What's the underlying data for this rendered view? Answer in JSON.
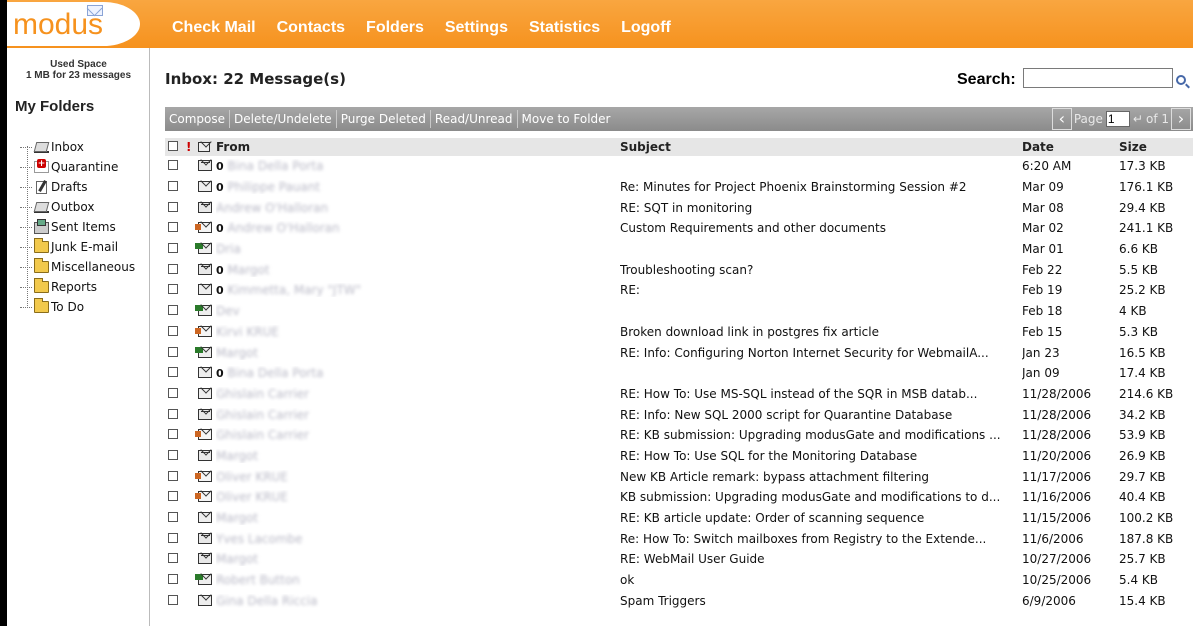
{
  "app": {
    "logo": "modus"
  },
  "nav": [
    "Check Mail",
    "Contacts",
    "Folders",
    "Settings",
    "Statistics",
    "Logoff"
  ],
  "sidebar": {
    "used_space_title": "Used Space",
    "used_space_value": "1 MB for 23 messages",
    "heading": "My Folders",
    "folders": [
      {
        "label": "Inbox",
        "icon": "inbox-icon"
      },
      {
        "label": "Quarantine",
        "icon": "quarantine-icon"
      },
      {
        "label": "Drafts",
        "icon": "drafts-icon"
      },
      {
        "label": "Outbox",
        "icon": "outbox-icon"
      },
      {
        "label": "Sent Items",
        "icon": "sent-items-icon"
      },
      {
        "label": "Junk E-mail",
        "icon": "folder-icon"
      },
      {
        "label": "Miscellaneous",
        "icon": "folder-icon"
      },
      {
        "label": "Reports",
        "icon": "folder-icon"
      },
      {
        "label": "To Do",
        "icon": "folder-icon"
      }
    ]
  },
  "main": {
    "title": "Inbox: 22 Message(s)",
    "search_label": "Search:",
    "search_value": "",
    "toolbar": [
      "Compose",
      "Delete/Undelete",
      "Purge Deleted",
      "Read/Unread",
      "Move to Folder"
    ],
    "pager": {
      "page_label": "Page",
      "page": "1",
      "of_label": "of 1"
    },
    "columns": {
      "flag": "!",
      "from": "From",
      "subject": "Subject",
      "date": "Date",
      "size": "Size"
    },
    "messages": [
      {
        "icon": "reply",
        "att": "0",
        "from": "Bina Della Porta",
        "subject": "",
        "date": "6:20 AM",
        "size": "17.3 KB"
      },
      {
        "icon": "read",
        "att": "0",
        "from": "Philippe Pauant",
        "subject": "Re: Minutes for Project Phoenix Brainstorming Session #2",
        "date": "Mar 09",
        "size": "176.1 KB"
      },
      {
        "icon": "reply",
        "att": "",
        "from": "Andrew O'Halloran",
        "subject": "RE: SQT in monitoring",
        "date": "Mar 08",
        "size": "29.4 KB"
      },
      {
        "icon": "replied",
        "att": "0",
        "from": "Andrew O'Halloran",
        "subject": "Custom Requirements and other documents",
        "date": "Mar 02",
        "size": "241.1 KB"
      },
      {
        "icon": "forward",
        "att": "",
        "from": "Dria",
        "subject": "",
        "date": "Mar 01",
        "size": "6.6 KB"
      },
      {
        "icon": "reply",
        "att": "0",
        "from": "Margot",
        "subject": "Troubleshooting scan?",
        "date": "Feb 22",
        "size": "5.5 KB"
      },
      {
        "icon": "read",
        "att": "0",
        "from": "Kimmetta, Mary \"JTW\"",
        "subject": "RE:",
        "date": "Feb 19",
        "size": "25.2 KB"
      },
      {
        "icon": "forward",
        "att": "",
        "from": "Dev",
        "subject": "",
        "date": "Feb 18",
        "size": "4 KB"
      },
      {
        "icon": "replied",
        "att": "",
        "from": "Kirvi KRUE",
        "subject": "Broken download link in postgres fix article",
        "date": "Feb 15",
        "size": "5.3 KB"
      },
      {
        "icon": "forward",
        "att": "",
        "from": "Margot",
        "subject": "RE: Info: Configuring Norton Internet Security for WebmailA...",
        "date": "Jan 23",
        "size": "16.5 KB"
      },
      {
        "icon": "read",
        "att": "0",
        "from": "Bina Della Porta",
        "subject": "",
        "date": "Jan 09",
        "size": "17.4 KB"
      },
      {
        "icon": "read",
        "att": "",
        "from": "Ghislain Carrier",
        "subject": "RE: How To: Use MS-SQL instead of the SQR in MSB datab...",
        "date": "11/28/2006",
        "size": "214.6 KB"
      },
      {
        "icon": "reply",
        "att": "",
        "from": "Ghislain Carrier",
        "subject": "RE: Info: New SQL 2000 script for Quarantine Database",
        "date": "11/28/2006",
        "size": "34.2 KB"
      },
      {
        "icon": "replied",
        "att": "",
        "from": "Ghislain Carrier",
        "subject": "RE: KB submission: Upgrading modusGate and modifications ...",
        "date": "11/28/2006",
        "size": "53.9 KB"
      },
      {
        "icon": "reply",
        "att": "",
        "from": "Margot",
        "subject": "RE: How To: Use SQL for the Monitoring Database",
        "date": "11/20/2006",
        "size": "26.9 KB"
      },
      {
        "icon": "replied",
        "att": "",
        "from": "Oliver KRUE",
        "subject": "New KB Article remark: bypass attachment filtering",
        "date": "11/17/2006",
        "size": "29.7 KB"
      },
      {
        "icon": "replied",
        "att": "",
        "from": "Oliver KRUE",
        "subject": "KB submission: Upgrading modusGate and modifications to d...",
        "date": "11/16/2006",
        "size": "40.4 KB"
      },
      {
        "icon": "read",
        "att": "",
        "from": "Margot",
        "subject": "RE: KB article update: Order of scanning sequence",
        "date": "11/15/2006",
        "size": "100.2 KB"
      },
      {
        "icon": "reply",
        "att": "",
        "from": "Yves Lacombe",
        "subject": "Re: How To: Switch mailboxes from Registry to the Extende...",
        "date": "11/6/2006",
        "size": "187.8 KB"
      },
      {
        "icon": "reply",
        "att": "",
        "from": "Margot",
        "subject": "RE: WebMail User Guide",
        "date": "10/27/2006",
        "size": "25.7 KB"
      },
      {
        "icon": "forward",
        "att": "",
        "from": "Robert Button",
        "subject": "ok",
        "date": "10/25/2006",
        "size": "5.4 KB"
      },
      {
        "icon": "read",
        "att": "",
        "from": "Gina Della Riccia",
        "subject": "Spam Triggers",
        "date": "6/9/2006",
        "size": "15.4 KB"
      }
    ]
  },
  "colors": {
    "accent": "#f6921e",
    "toolbar": "#9a9a9a",
    "header_row": "#e6e6e6"
  }
}
